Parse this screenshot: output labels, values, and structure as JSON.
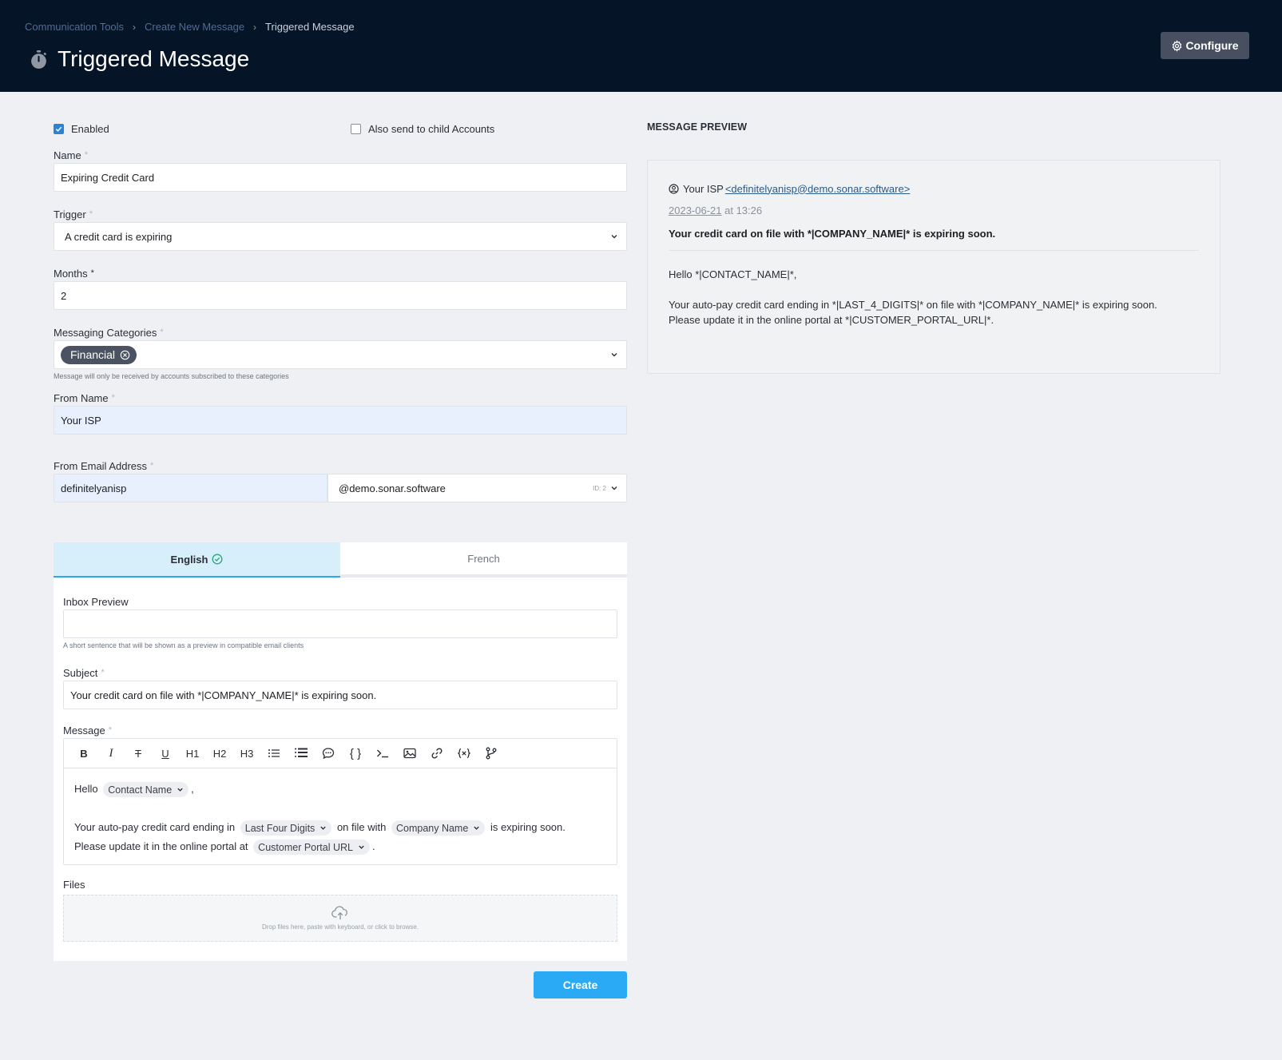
{
  "header": {
    "breadcrumbs": [
      "Communication Tools",
      "Create New Message",
      "Triggered Message"
    ],
    "title": "Triggered Message",
    "title_icon": "stopwatch-icon",
    "configure_label": "Configure"
  },
  "form": {
    "enabled_label": "Enabled",
    "enabled_checked": true,
    "child_accounts_label": "Also send to child Accounts",
    "child_accounts_checked": false,
    "name_label": "Name",
    "name_value": "Expiring Credit Card",
    "trigger_label": "Trigger",
    "trigger_value": "A credit card is expiring",
    "months_label": "Months",
    "months_value": "2",
    "categories_label": "Messaging Categories",
    "categories_chip": "Financial",
    "categories_hint": "Message will only be received by accounts subscribed to these categories",
    "from_name_label": "From Name",
    "from_name_value": "Your ISP",
    "from_email_label": "From Email Address",
    "from_email_local": "definitelyanisp",
    "from_email_domain": "@demo.sonar.software",
    "from_email_id": "ID: 2",
    "tabs": [
      {
        "label": "English",
        "active": true
      },
      {
        "label": "French",
        "active": false
      }
    ],
    "inbox_preview_label": "Inbox Preview",
    "inbox_preview_value": "",
    "inbox_preview_hint": "A short sentence that will be shown as a preview in compatible email clients",
    "subject_label": "Subject",
    "subject_value": "Your credit card on file with *|COMPANY_NAME|* is expiring soon.",
    "message_label": "Message",
    "toolbar": [
      "B",
      "I",
      "T",
      "U",
      "H1",
      "H2",
      "H3"
    ],
    "message": {
      "hello": "Hello",
      "contact_name": "Contact Name",
      "comma": ",",
      "line2_a": "Your auto-pay credit card ending in",
      "last_four": "Last Four Digits",
      "line2_b": "on file with",
      "company_name": "Company Name",
      "line2_c": "is expiring soon.",
      "line3_a": "Please update it in the online portal at",
      "portal_url": "Customer Portal URL",
      "period": "."
    },
    "files_label": "Files",
    "dropzone_text": "Drop files here, paste with keyboard, or click to browse.",
    "create_label": "Create"
  },
  "preview": {
    "title": "MESSAGE PREVIEW",
    "from_name": "Your ISP",
    "from_email": "<definitelyanisp@demo.sonar.software>",
    "date": "2023-06-21",
    "time": "at 13:26",
    "subject": "Your credit card on file with *|COMPANY_NAME|* is expiring soon.",
    "greeting": "Hello *|CONTACT_NAME|*,",
    "body_line1": "Your auto-pay credit card ending in *|LAST_4_DIGITS|* on file with *|COMPANY_NAME|* is expiring soon.",
    "body_line2": "Please update it in the online portal at *|CUSTOMER_PORTAL_URL|*."
  },
  "colors": {
    "header_bg": "#061427",
    "accent": "#2aa9f4",
    "chip_bg": "#4b5261"
  }
}
